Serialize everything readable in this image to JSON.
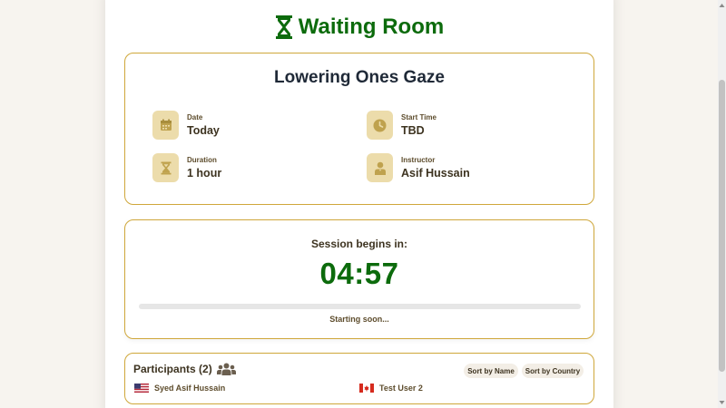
{
  "header": {
    "title": "Waiting Room"
  },
  "session": {
    "name": "Lowering Ones Gaze",
    "date_label": "Date",
    "date_value": "Today",
    "start_label": "Start Time",
    "start_value": "TBD",
    "duration_label": "Duration",
    "duration_value": "1 hour",
    "instructor_label": "Instructor",
    "instructor_value": "Asif Hussain"
  },
  "timer": {
    "begins_label": "Session begins in:",
    "countdown": "04:57",
    "progress": 0,
    "status": "Starting soon..."
  },
  "participants": {
    "title": "Participants (2)",
    "sort_name_label": "Sort by Name",
    "sort_country_label": "Sort by Country",
    "list": [
      {
        "name": "Syed Asif Hussain",
        "flag": "us-flag-icon"
      },
      {
        "name": "Test User 2",
        "flag": "ca-flag-icon"
      }
    ]
  },
  "colors": {
    "accent_green": "#0c6b0c",
    "border_gold": "#cfa73a",
    "icon_bg": "#ecdcab",
    "icon_fg": "#bfa24e"
  }
}
